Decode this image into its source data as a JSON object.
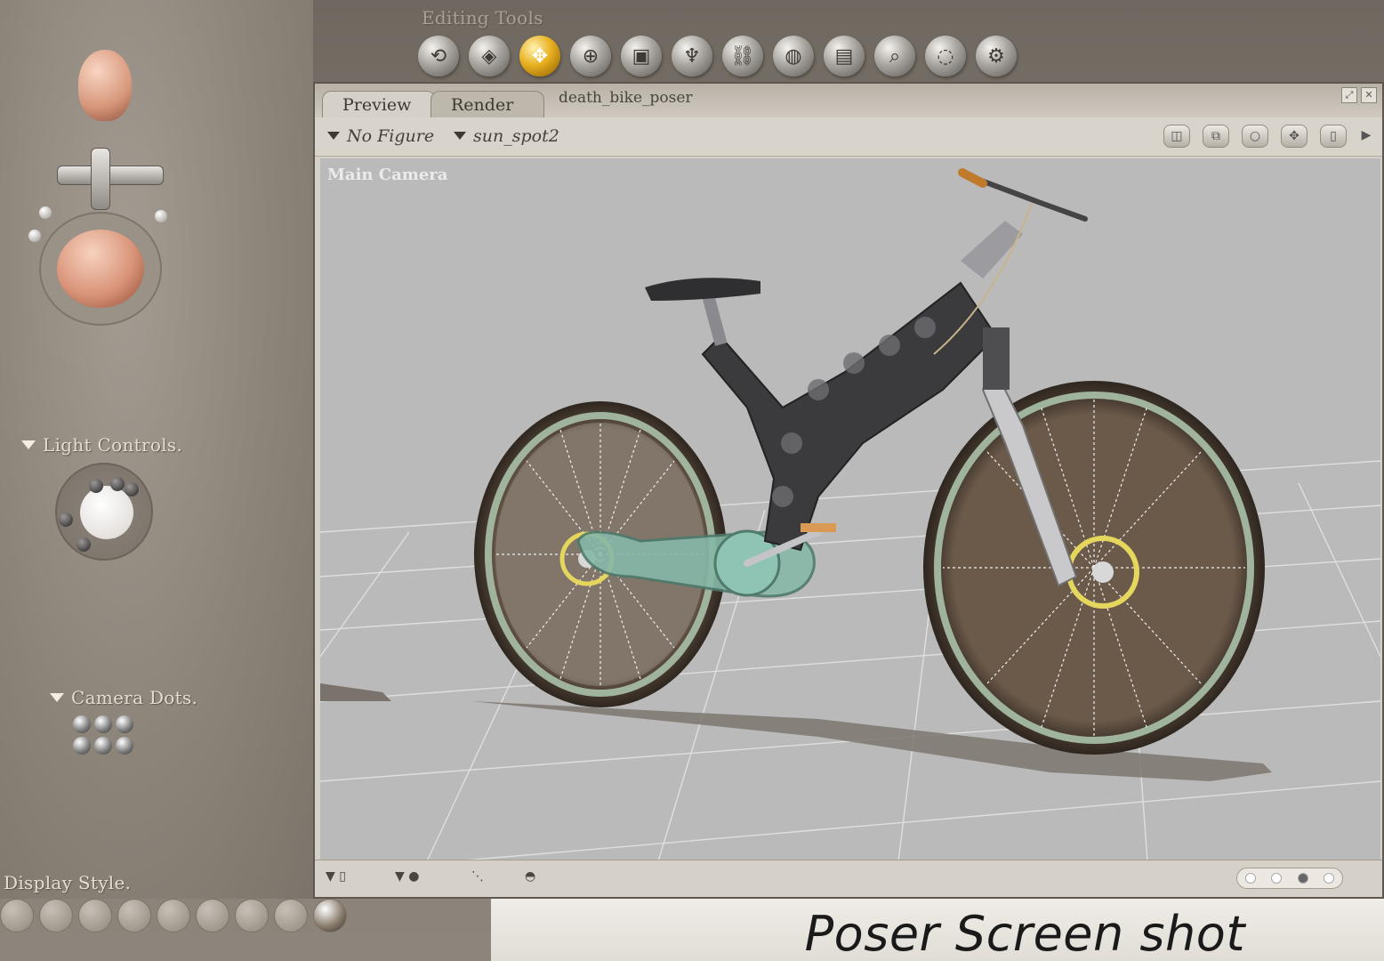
{
  "editing_tools": {
    "title": "Editing Tools",
    "tools": [
      {
        "name": "rotate",
        "glyph": "⟲"
      },
      {
        "name": "twist",
        "glyph": "◈"
      },
      {
        "name": "translate",
        "glyph": "✥",
        "active": true
      },
      {
        "name": "translate-in-out",
        "glyph": "⊕"
      },
      {
        "name": "scale",
        "glyph": "▣"
      },
      {
        "name": "taper",
        "glyph": "♆"
      },
      {
        "name": "chain-break",
        "glyph": "⛓"
      },
      {
        "name": "color",
        "glyph": "◍"
      },
      {
        "name": "grouping",
        "glyph": "▤"
      },
      {
        "name": "view-magnifier",
        "glyph": "⌕"
      },
      {
        "name": "morphing",
        "glyph": "◌"
      },
      {
        "name": "direct-manipulation",
        "glyph": "⚙"
      }
    ]
  },
  "window": {
    "tabs": [
      "Preview",
      "Render"
    ],
    "active_tab": "Preview",
    "document_name": "death_bike_poser",
    "figure_dropdown": "No Figure",
    "light_dropdown": "sun_spot2",
    "camera_label": "Main Camera"
  },
  "left_panel": {
    "light_controls_title": "Light Controls.",
    "camera_dots_title": "Camera Dots.",
    "display_style_title": "Display Style."
  },
  "caption": "Poser Screen shot",
  "colors": {
    "accent_active_tool": "#e8b020",
    "viewport_bg": "#b9b9b9",
    "panel_bg": "#8c8479",
    "bike_frame": "#3b3a3c",
    "bike_rim": "#9fb39d"
  }
}
